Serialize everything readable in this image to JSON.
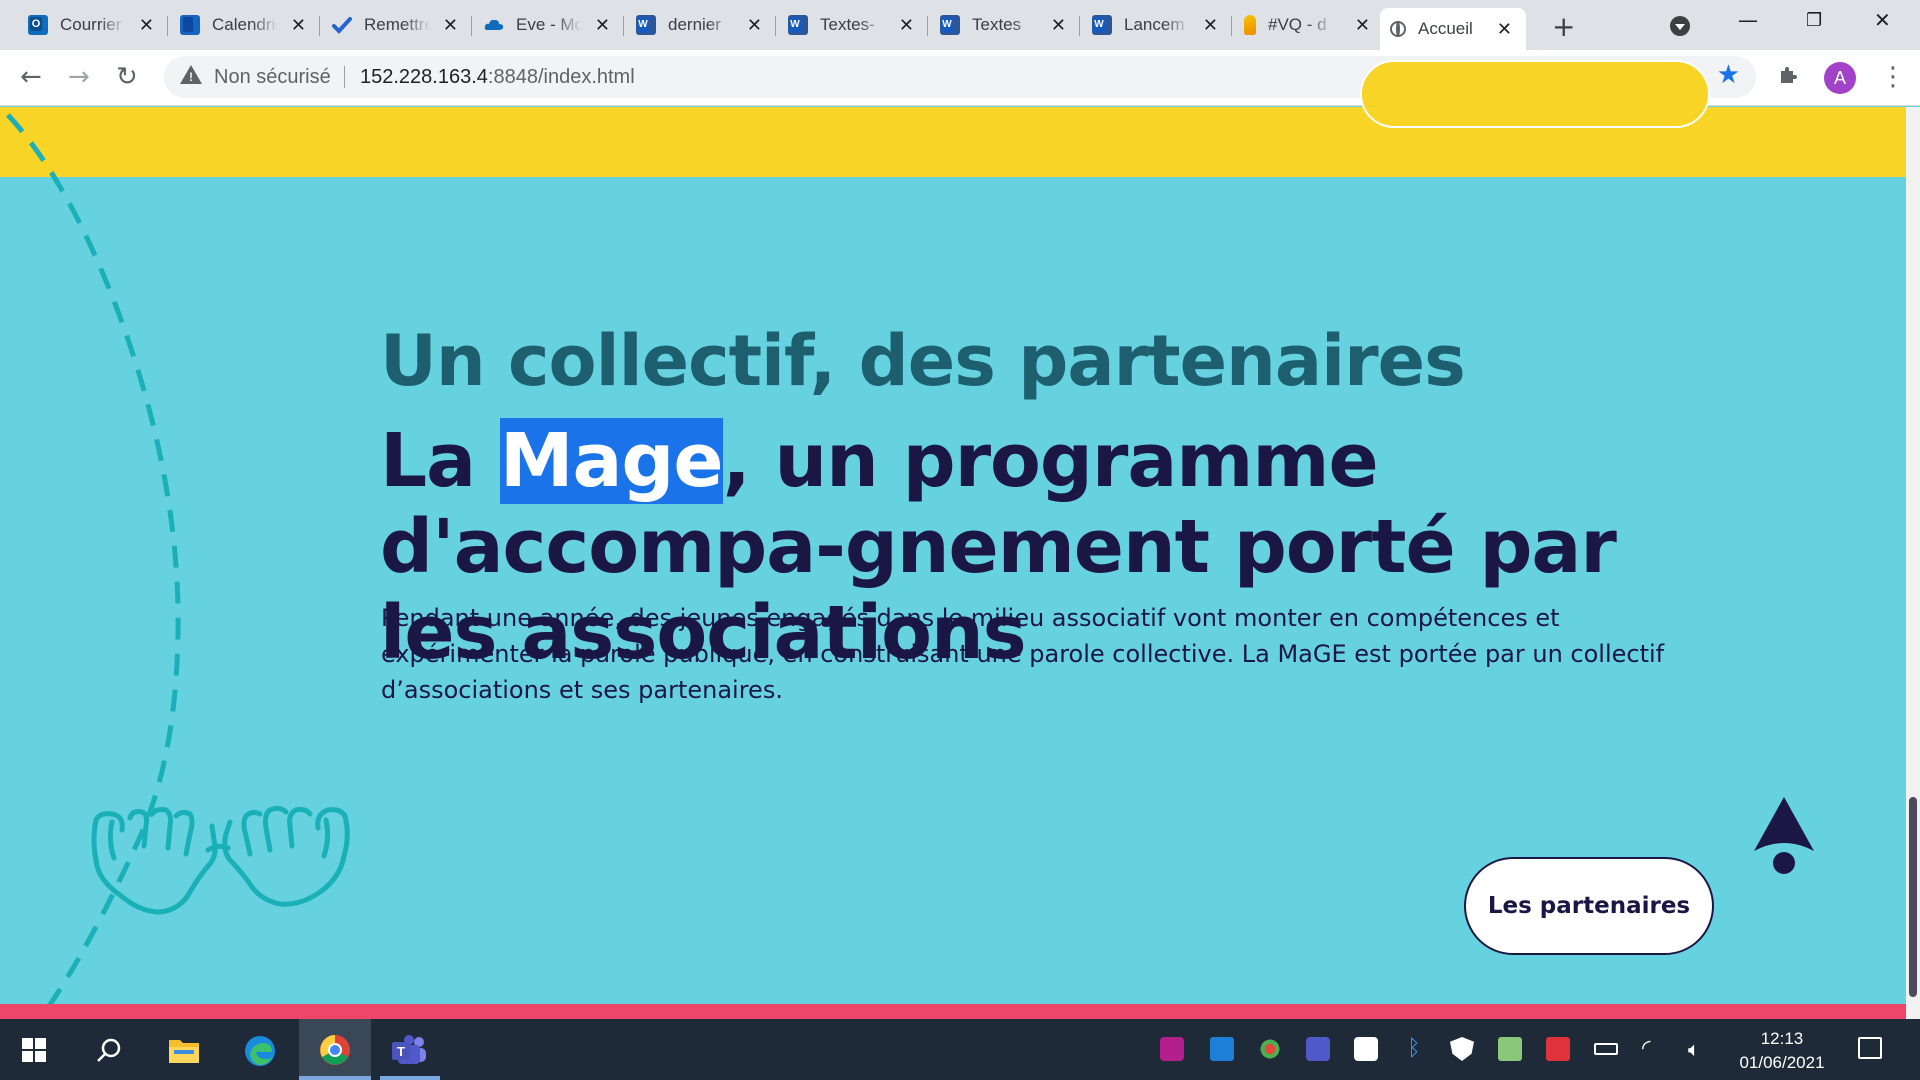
{
  "browser": {
    "tabs": [
      {
        "title": "Courrier",
        "icon": "outlook-icon"
      },
      {
        "title": "Calendrier",
        "icon": "calendar-icon"
      },
      {
        "title": "Remettre",
        "icon": "todo-icon"
      },
      {
        "title": "Eve - Mo",
        "icon": "onedrive-icon"
      },
      {
        "title": "dernier",
        "icon": "word-icon"
      },
      {
        "title": "Textes-",
        "icon": "word-icon"
      },
      {
        "title": "Textes",
        "icon": "word-icon"
      },
      {
        "title": "Lancem",
        "icon": "word-icon"
      },
      {
        "title": "#VQ - d",
        "icon": "vq-icon"
      },
      {
        "title": "Accueil",
        "icon": "globe-icon",
        "active": true
      }
    ],
    "new_tab": "+",
    "security_label": "Non sécurisé",
    "url_host": "152.228.163.4",
    "url_rest": ":8848/index.html",
    "avatar_letter": "A",
    "accent_color": "#1a73e8"
  },
  "page": {
    "subtitle": "Un collectif, des partenaires",
    "title_before": "La ",
    "title_highlight": "Mage",
    "title_after": ", un programme d'accompa-gnement porté par les associations",
    "paragraph": "Pendant une année, des jeunes engagés dans le milieu associatif vont monter en compétences et expérimenter la parole publique, en construisant une parole collective. La MaGE est portée par un collectif d’associations et ses partenaires.",
    "partners_button": "Les partenaires",
    "colors": {
      "background": "#66d1df",
      "yellow_band": "#f7d426",
      "pink_band": "#ee4669",
      "subtitle": "#1d5f6e",
      "title": "#1b1745"
    }
  },
  "taskbar": {
    "time": "12:13",
    "date": "01/06/2021",
    "pinned": [
      "windows-start-icon",
      "search-icon",
      "file-explorer-icon",
      "edge-icon",
      "chrome-icon",
      "teams-icon"
    ]
  }
}
